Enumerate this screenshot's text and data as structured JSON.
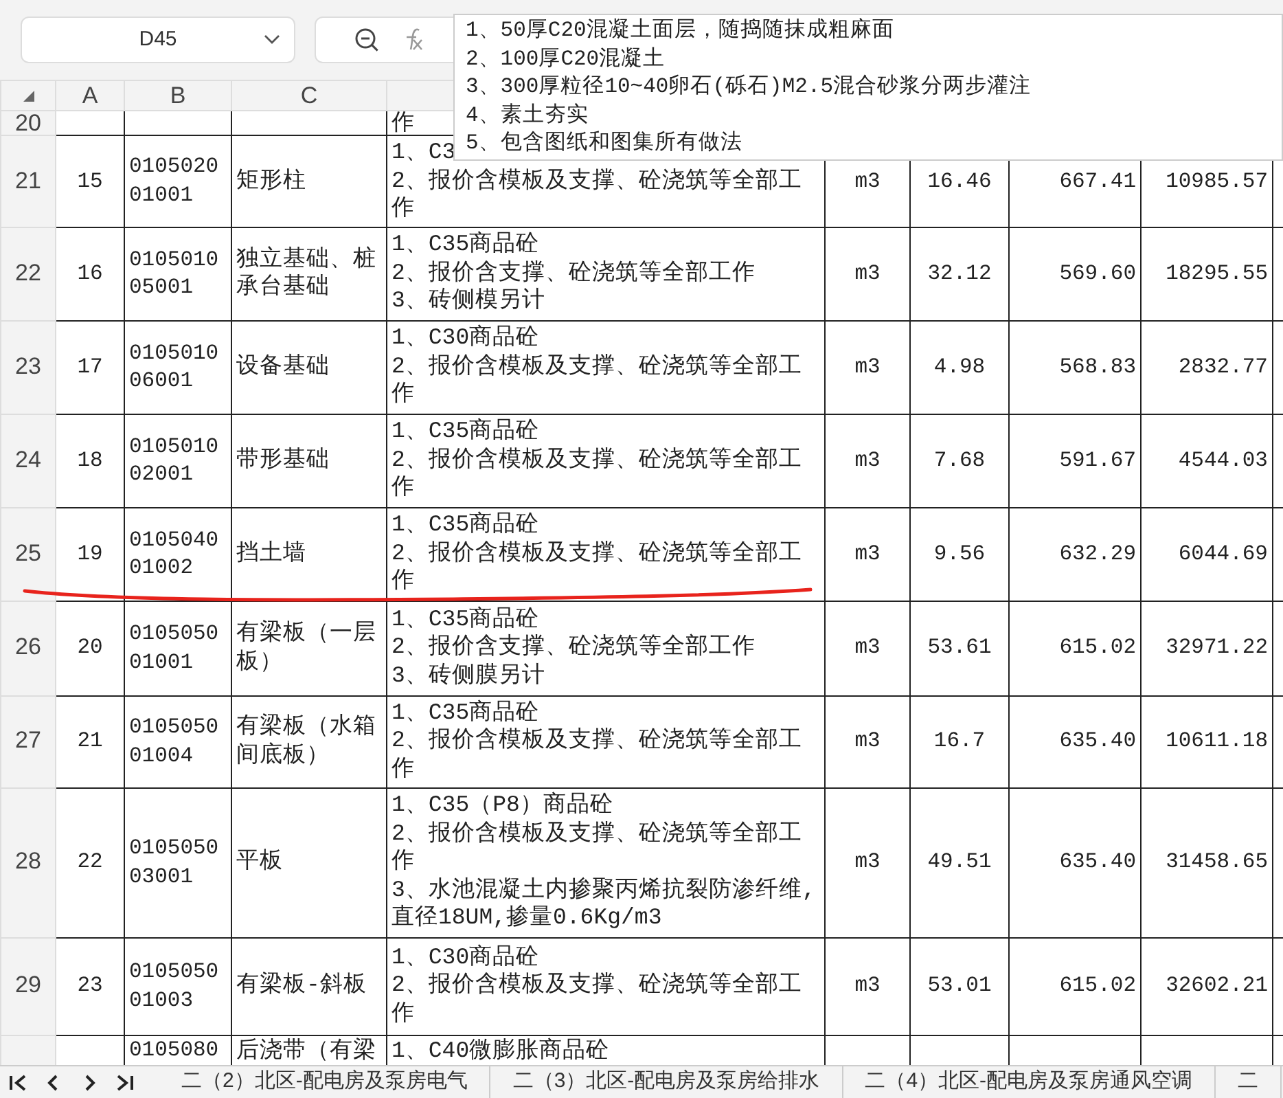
{
  "name_box": {
    "value": "D45"
  },
  "formula_popup": {
    "lines": [
      "1、50厚C20混凝土面层，随捣随抹成粗麻面",
      "2、100厚C20混凝土",
      "3、300厚粒径10~40卵石(砾石)M2.5混合砂浆分两步灌注",
      "4、素土夯实",
      "5、包含图纸和图集所有做法"
    ]
  },
  "columns": [
    "A",
    "B",
    "C",
    "",
    "",
    "",
    "",
    "",
    ""
  ],
  "rows": [
    {
      "row": "20",
      "no": "",
      "code": "",
      "name": "",
      "desc": [
        "作"
      ],
      "unit": "",
      "qty": "",
      "price": "",
      "total": ""
    },
    {
      "row": "21",
      "no": "15",
      "code": "010502001001",
      "name": "矩形柱",
      "desc": [
        "1、C3",
        "2、报价含模板及支撑、砼浇筑等全部工作"
      ],
      "unit": "m3",
      "qty": "16.46",
      "price": "667.41",
      "total": "10985.57"
    },
    {
      "row": "22",
      "no": "16",
      "code": "010501005001",
      "name": "独立基础、桩承台基础",
      "desc": [
        "1、C35商品砼",
        "2、报价含支撑、砼浇筑等全部工作",
        "3、砖侧模另计"
      ],
      "unit": "m3",
      "qty": "32.12",
      "price": "569.60",
      "total": "18295.55"
    },
    {
      "row": "23",
      "no": "17",
      "code": "010501006001",
      "name": "设备基础",
      "desc": [
        "1、C30商品砼",
        "2、报价含模板及支撑、砼浇筑等全部工作"
      ],
      "unit": "m3",
      "qty": "4.98",
      "price": "568.83",
      "total": "2832.77"
    },
    {
      "row": "24",
      "no": "18",
      "code": "010501002001",
      "name": "带形基础",
      "desc": [
        "1、C35商品砼",
        "2、报价含模板及支撑、砼浇筑等全部工作"
      ],
      "unit": "m3",
      "qty": "7.68",
      "price": "591.67",
      "total": "4544.03"
    },
    {
      "row": "25",
      "no": "19",
      "code": "010504001002",
      "name": "挡土墙",
      "desc": [
        "1、C35商品砼",
        "2、报价含模板及支撑、砼浇筑等全部工作"
      ],
      "unit": "m3",
      "qty": "9.56",
      "price": "632.29",
      "total": "6044.69"
    },
    {
      "row": "26",
      "no": "20",
      "code": "010505001001",
      "name": "有梁板（一层板）",
      "desc": [
        "1、C35商品砼",
        "2、报价含支撑、砼浇筑等全部工作",
        "3、砖侧膜另计"
      ],
      "unit": "m3",
      "qty": "53.61",
      "price": "615.02",
      "total": "32971.22"
    },
    {
      "row": "27",
      "no": "21",
      "code": "010505001004",
      "name": "有梁板（水箱间底板）",
      "desc": [
        "1、C35商品砼",
        "2、报价含模板及支撑、砼浇筑等全部工作"
      ],
      "unit": "m3",
      "qty": "16.7",
      "price": "635.40",
      "total": "10611.18"
    },
    {
      "row": "28",
      "no": "22",
      "code": "010505003001",
      "name": "平板",
      "desc": [
        "1、C35（P8）商品砼",
        "2、报价含模板及支撑、砼浇筑等全部工作",
        "3、水池混凝土内掺聚丙烯抗裂防渗纤维,直径18UM,掺量0.6Kg/m3"
      ],
      "unit": "m3",
      "qty": "49.51",
      "price": "635.40",
      "total": "31458.65"
    },
    {
      "row": "29",
      "no": "23",
      "code": "010505001003",
      "name": "有梁板-斜板",
      "desc": [
        "1、C30商品砼",
        "2、报价含模板及支撑、砼浇筑等全部工作"
      ],
      "unit": "m3",
      "qty": "53.01",
      "price": "615.02",
      "total": "32602.21"
    },
    {
      "row": "",
      "no": "",
      "code": "0105080",
      "name": "后浇带（有梁",
      "desc": [
        "1、C40微膨胀商品砼"
      ],
      "unit": "",
      "qty": "",
      "price": "",
      "total": ""
    }
  ],
  "sheet_tabs": [
    {
      "label": "二（2）北区-配电房及泵房电气",
      "selected": false
    },
    {
      "label": "二（3）北区-配电房及泵房给排水",
      "selected": false
    },
    {
      "label": "二（4）北区-配电房及泵房通风空调",
      "selected": false
    },
    {
      "label": "二",
      "selected": false
    }
  ]
}
